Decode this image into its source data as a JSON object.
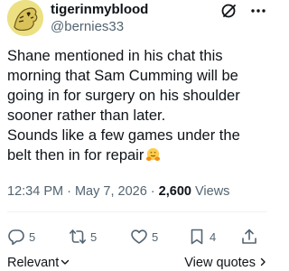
{
  "author": {
    "display_name": "tigerinmyblood",
    "handle": "@bernies33",
    "avatar_icon": "tiger-avatar"
  },
  "tweet": {
    "paragraph_1": "Shane mentioned in his chat this morning that Sam Cumming will be going in for surgery on his shoulder sooner rather than later.",
    "paragraph_2": "Sounds like a few games under the belt then in for repair",
    "emoji_icon": "hugging-face-emoji"
  },
  "meta": {
    "time": "12:34 PM",
    "separator": " · ",
    "date": "May 7, 2026",
    "views_count": "2,600",
    "views_label": " Views"
  },
  "actions": {
    "replies": "5",
    "reposts": "5",
    "likes": "5",
    "bookmarks": "4"
  },
  "footer": {
    "sort_label": "Relevant",
    "view_quotes_label": "View quotes"
  },
  "colors": {
    "text_primary": "#0f1419",
    "text_secondary": "#536471",
    "divider": "#eff3f4",
    "avatar_bg": "#e9da7a"
  }
}
